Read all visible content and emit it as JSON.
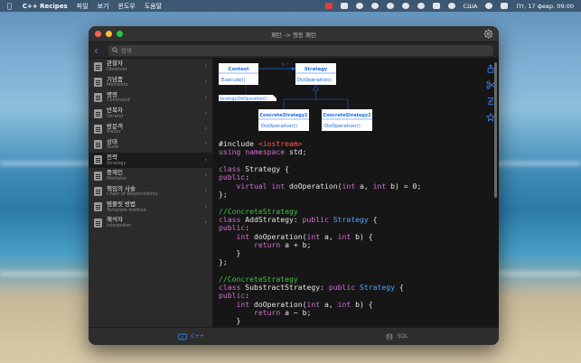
{
  "menubar": {
    "app_name": "C++ Recipes",
    "menus": [
      "파일",
      "보기",
      "윈도우",
      "도움말"
    ],
    "tray_text_1": "США",
    "datetime": "Пт, 17 февр.  09:00"
  },
  "window": {
    "title": "패턴 -> 행동 패턴"
  },
  "search": {
    "placeholder": "검색"
  },
  "sidebar": {
    "items": [
      {
        "title": "관찰자",
        "subtitle": "Observer"
      },
      {
        "title": "기념품",
        "subtitle": "Memento"
      },
      {
        "title": "명령",
        "subtitle": "Command"
      },
      {
        "title": "반복자",
        "subtitle": "Iterator"
      },
      {
        "title": "방문객",
        "subtitle": "Visitor"
      },
      {
        "title": "상태",
        "subtitle": "State"
      },
      {
        "title": "전략",
        "subtitle": "Strategy"
      },
      {
        "title": "중재인",
        "subtitle": "Mediator"
      },
      {
        "title": "책임의 사슬",
        "subtitle": "Chain of Responsibility"
      },
      {
        "title": "템플릿 방법",
        "subtitle": "Template method"
      },
      {
        "title": "해석자",
        "subtitle": "Interpreter"
      }
    ],
    "active_index": 6
  },
  "diagram": {
    "context_title": "Context",
    "context_method": "Execute()",
    "strategy_title": "Strategy",
    "strategy_method": "DoOperation(",
    "note": "strategy.DoOperation()",
    "cs1_title": "ConcreteStrategy1",
    "cs1_method": "DoOperation()",
    "cs2_title": "ConcreteStrategy2",
    "cs2_method": "DoOperation()",
    "multiplicity": "0..*",
    "accent_color": "#1e6be0"
  },
  "code": {
    "lines": [
      [
        {
          "t": "#include ",
          "c": "plain"
        },
        {
          "t": "<iostream>",
          "c": "string"
        }
      ],
      [
        {
          "t": "using namespace ",
          "c": "keyword"
        },
        {
          "t": "std",
          "c": "plain"
        },
        {
          "t": ";",
          "c": "plain"
        }
      ],
      [],
      [
        {
          "t": "class ",
          "c": "keyword"
        },
        {
          "t": "Strategy {",
          "c": "plain"
        }
      ],
      [
        {
          "t": "public",
          "c": "keyword"
        },
        {
          "t": ":",
          "c": "plain"
        }
      ],
      [
        {
          "t": "    virtual int ",
          "c": "keyword"
        },
        {
          "t": "doOperation(",
          "c": "plain"
        },
        {
          "t": "int ",
          "c": "keyword"
        },
        {
          "t": "a, ",
          "c": "plain"
        },
        {
          "t": "int ",
          "c": "keyword"
        },
        {
          "t": "b) = 0;",
          "c": "plain"
        }
      ],
      [
        {
          "t": "};",
          "c": "plain"
        }
      ],
      [],
      [
        {
          "t": "//ConcreteStrategy",
          "c": "comment"
        }
      ],
      [
        {
          "t": "class ",
          "c": "keyword"
        },
        {
          "t": "AddStrategy: ",
          "c": "plain"
        },
        {
          "t": "public ",
          "c": "keyword"
        },
        {
          "t": "Strategy ",
          "c": "type"
        },
        {
          "t": "{",
          "c": "plain"
        }
      ],
      [
        {
          "t": "public",
          "c": "keyword"
        },
        {
          "t": ":",
          "c": "plain"
        }
      ],
      [
        {
          "t": "    int ",
          "c": "keyword"
        },
        {
          "t": "doOperation(",
          "c": "plain"
        },
        {
          "t": "int ",
          "c": "keyword"
        },
        {
          "t": "a, ",
          "c": "plain"
        },
        {
          "t": "int ",
          "c": "keyword"
        },
        {
          "t": "b) {",
          "c": "plain"
        }
      ],
      [
        {
          "t": "        return ",
          "c": "keyword"
        },
        {
          "t": "a + b;",
          "c": "plain"
        }
      ],
      [
        {
          "t": "    }",
          "c": "plain"
        }
      ],
      [
        {
          "t": "};",
          "c": "plain"
        }
      ],
      [],
      [
        {
          "t": "//ConcreteStrategy",
          "c": "comment"
        }
      ],
      [
        {
          "t": "class ",
          "c": "keyword"
        },
        {
          "t": "SubstractStrategy: ",
          "c": "plain"
        },
        {
          "t": "public ",
          "c": "keyword"
        },
        {
          "t": "Strategy ",
          "c": "type"
        },
        {
          "t": "{",
          "c": "plain"
        }
      ],
      [
        {
          "t": "public",
          "c": "keyword"
        },
        {
          "t": ":",
          "c": "plain"
        }
      ],
      [
        {
          "t": "    int ",
          "c": "keyword"
        },
        {
          "t": "doOperation(",
          "c": "plain"
        },
        {
          "t": "int ",
          "c": "keyword"
        },
        {
          "t": "a, ",
          "c": "plain"
        },
        {
          "t": "int ",
          "c": "keyword"
        },
        {
          "t": "b) {",
          "c": "plain"
        }
      ],
      [
        {
          "t": "        return ",
          "c": "keyword"
        },
        {
          "t": "a − b;",
          "c": "plain"
        }
      ],
      [
        {
          "t": "    }",
          "c": "plain"
        }
      ]
    ]
  },
  "bottom_tabs": [
    {
      "label": "C++",
      "active": true
    },
    {
      "label": "SQL",
      "active": false
    }
  ],
  "icons": {
    "share": "share-icon",
    "cut": "scissors-icon",
    "sort": "sort-icon",
    "star": "star-icon",
    "gear": "gear-icon"
  }
}
